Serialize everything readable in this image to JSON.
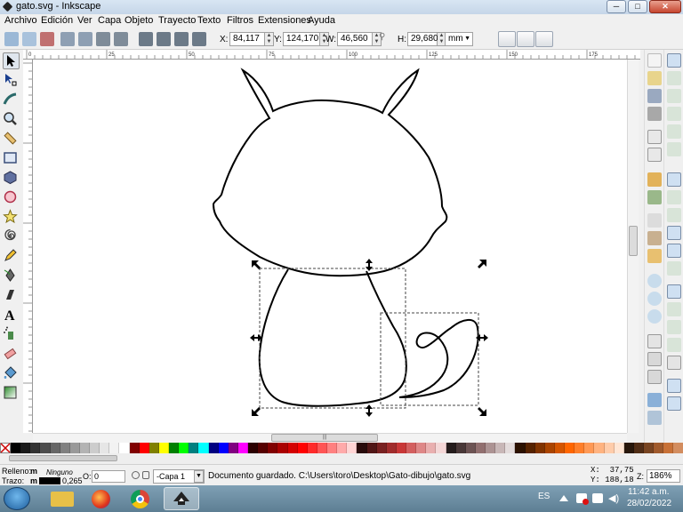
{
  "window": {
    "title": "gato.svg - Inkscape",
    "min": "─",
    "max": "□",
    "close": "✕"
  },
  "menu": [
    "Archivo",
    "Edición",
    "Ver",
    "Capa",
    "Objeto",
    "Trayecto",
    "Texto",
    "Filtros",
    "Extensiones",
    "Ayuda"
  ],
  "controls": {
    "x_label": "X:",
    "x_value": "84,117",
    "y_label": "Y:",
    "y_value": "124,170",
    "w_label": "W:",
    "w_value": "46,560",
    "h_label": "H:",
    "h_value": "29,680",
    "unit": "mm"
  },
  "status": {
    "fill_label": "Relleno:",
    "fill_value": "m",
    "fill_none": "Ninguno",
    "stroke_label": "Trazo:",
    "stroke_value": "m",
    "stroke_width": "0,265",
    "opacity_label": "O:",
    "opacity_value": "0",
    "layer": "-Capa 1",
    "message": "Documento guardado. C:\\Users\\toro\\Desktop\\Gato-dibujo\\gato.svg",
    "x_label": "X:",
    "x_coord": "37,75",
    "y_label": "Y:",
    "y_coord": "188,18",
    "zoom_label": "Z:",
    "zoom": "186%"
  },
  "ruler": {
    "h_ticks": [
      "0",
      "25",
      "50",
      "75",
      "100",
      "125",
      "150",
      "175"
    ]
  },
  "taskbar": {
    "lang": "ES",
    "time": "11:42 a.m.",
    "date": "28/02/2022"
  },
  "colors": {
    "palette": [
      "#000000",
      "#1a1a1a",
      "#333333",
      "#4d4d4d",
      "#666666",
      "#808080",
      "#999999",
      "#b3b3b3",
      "#cccccc",
      "#e6e6e6",
      "#f2f2f2",
      "#ffffff",
      "#800000",
      "#ff0000",
      "#808000",
      "#ffff00",
      "#008000",
      "#00ff00",
      "#008080",
      "#00ffff",
      "#000080",
      "#0000ff",
      "#800080",
      "#ff00ff",
      "#2b0000",
      "#550000",
      "#800000",
      "#aa0000",
      "#d40000",
      "#ff0000",
      "#ff2a2a",
      "#ff5555",
      "#ff8080",
      "#ffaaaa",
      "#ffd5d5",
      "#280b0b",
      "#501616",
      "#782121",
      "#a02c2c",
      "#c83737",
      "#d35f5f",
      "#de8787",
      "#e9afaf",
      "#f4d7d7",
      "#241c1c",
      "#483737",
      "#6c5353",
      "#916f6f",
      "#ac9393",
      "#c8b7b7",
      "#e3dbdb",
      "#2b1100",
      "#552200",
      "#803300",
      "#aa4400",
      "#d45500",
      "#ff6600",
      "#ff7f2a",
      "#ff9955",
      "#ffb380",
      "#ffccaa",
      "#ffe6d5",
      "#28170b",
      "#502d16",
      "#784421",
      "#a05a2c",
      "#c87137",
      "#d38d5f"
    ]
  }
}
